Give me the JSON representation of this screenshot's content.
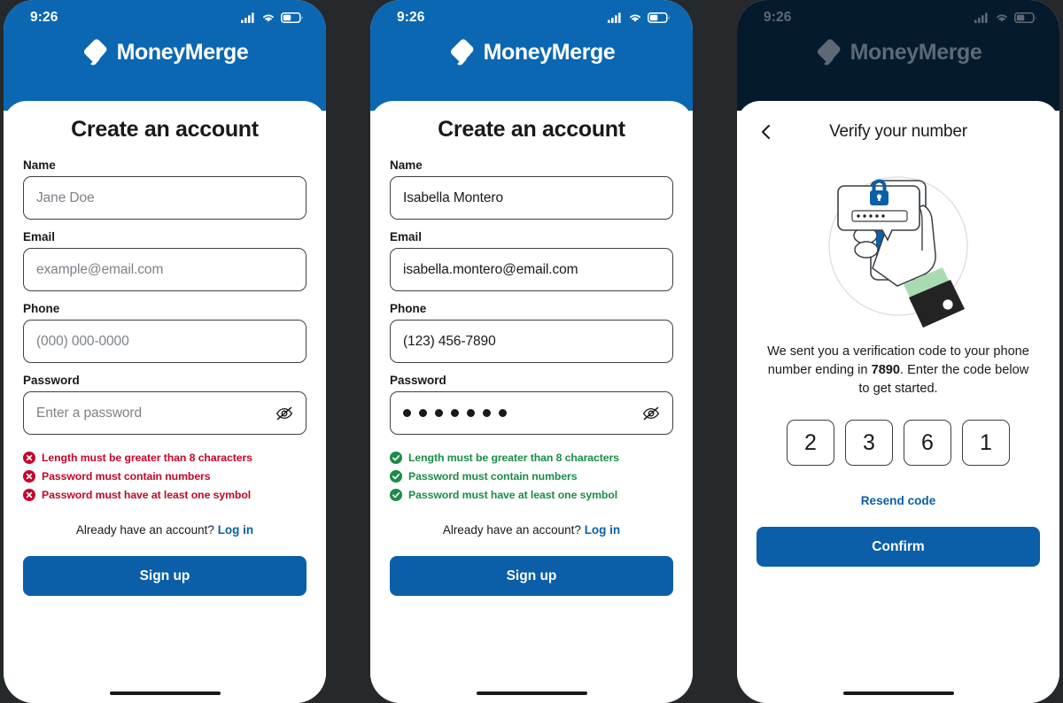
{
  "brand": {
    "name": "MoneyMerge",
    "accent_blue": "#0B67B2",
    "button_blue": "#0B5FA8",
    "dim_navy": "#061A2E",
    "error_red": "#C4062A",
    "success_green": "#1A8D46"
  },
  "status_bar": {
    "time": "9:26",
    "signal_icon": "signal-bars-icon",
    "wifi_icon": "wifi-icon",
    "battery_icon": "battery-icon"
  },
  "screens": [
    {
      "id": "signup-empty",
      "title": "Create an account",
      "fields": [
        {
          "label": "Name",
          "value": "",
          "placeholder": "Jane Doe"
        },
        {
          "label": "Email",
          "value": "",
          "placeholder": "example@email.com"
        },
        {
          "label": "Phone",
          "value": "",
          "placeholder": "(000) 000-0000"
        },
        {
          "label": "Password",
          "value": "",
          "placeholder": "Enter a password"
        }
      ],
      "password_toggle_icon": "eye-off-icon",
      "rules": [
        {
          "text": "Length must be greater than 8 characters",
          "state": "error"
        },
        {
          "text": "Password must contain numbers",
          "state": "error"
        },
        {
          "text": "Password must have at least one symbol",
          "state": "error"
        }
      ],
      "login_prompt": "Already have an account?",
      "login_link": "Log in",
      "cta_label": "Sign up"
    },
    {
      "id": "signup-filled",
      "title": "Create an account",
      "fields": [
        {
          "label": "Name",
          "value": "Isabella Montero",
          "placeholder": "Jane Doe"
        },
        {
          "label": "Email",
          "value": "isabella.montero@email.com",
          "placeholder": "example@email.com"
        },
        {
          "label": "Phone",
          "value": "(123) 456-7890",
          "placeholder": "(000) 000-0000"
        },
        {
          "label": "Password",
          "value": "•••••••",
          "placeholder": "Enter a password",
          "masked_count": 7
        }
      ],
      "password_toggle_icon": "eye-off-icon",
      "rules": [
        {
          "text": "Length must be greater than 8 characters",
          "state": "success"
        },
        {
          "text": "Password must contain numbers",
          "state": "success"
        },
        {
          "text": "Password must have at least one symbol",
          "state": "success"
        }
      ],
      "login_prompt": "Already have an account?",
      "login_link": "Log in",
      "cta_label": "Sign up"
    }
  ],
  "verify": {
    "back_icon": "chevron-left-icon",
    "title": "Verify your number",
    "illustration": "hand-holding-phone-with-password-lock-illustration",
    "copy_part1": "We sent you a verification code to your phone number ending in ",
    "copy_digits": "7890",
    "copy_part2": ". Enter the code below to get started.",
    "code": [
      "2",
      "3",
      "6",
      "1"
    ],
    "resend_label": "Resend code",
    "cta_label": "Confirm"
  }
}
